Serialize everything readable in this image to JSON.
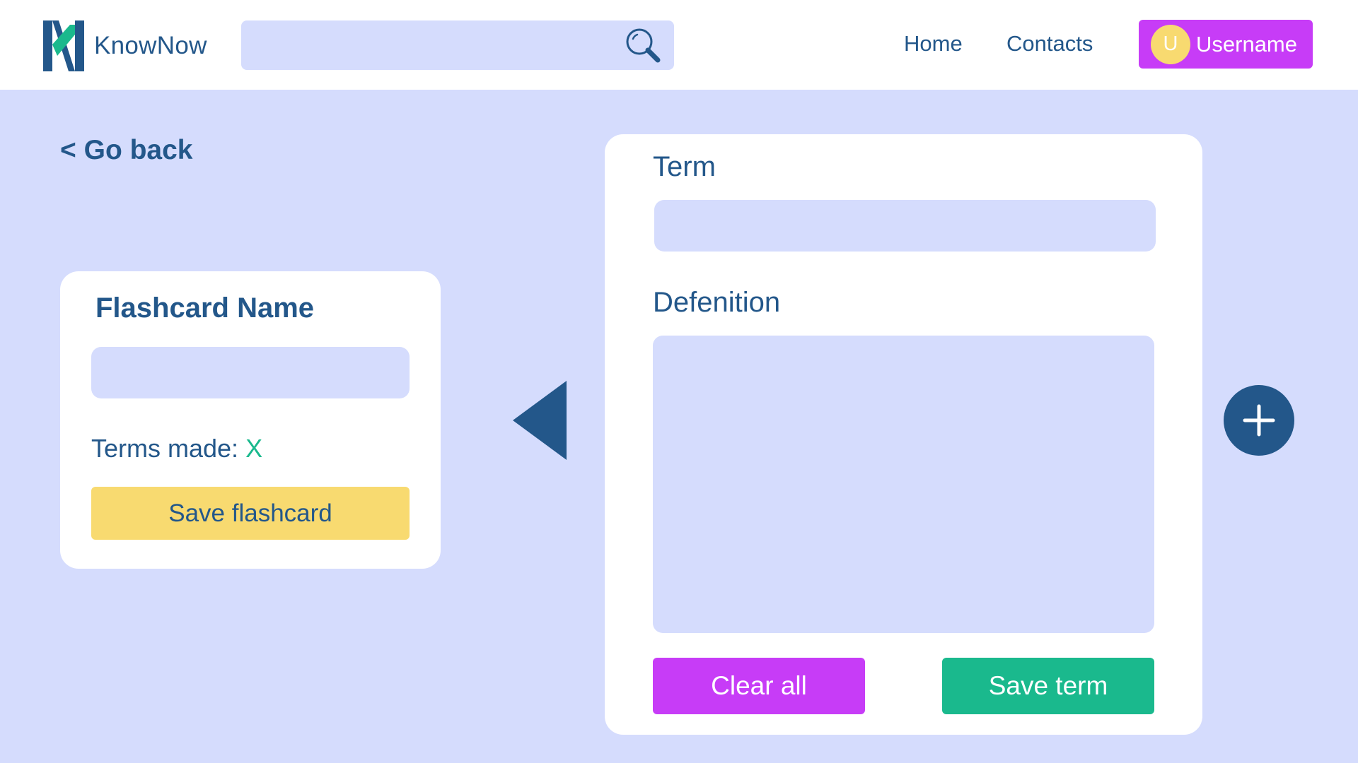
{
  "header": {
    "brand": "KnowNow",
    "search": {
      "placeholder": "",
      "value": "",
      "icon": "search-icon"
    },
    "nav": [
      {
        "label": "Home"
      },
      {
        "label": "Contacts"
      }
    ],
    "user": {
      "avatar_initial": "U",
      "name": "Username"
    }
  },
  "go_back_label": "< Go back",
  "flashcard_panel": {
    "title": "Flashcard Name",
    "name_value": "",
    "terms_made_label": "Terms made:",
    "terms_made_count": "X",
    "save_label": "Save flashcard"
  },
  "term_panel": {
    "term_label": "Term",
    "term_value": "",
    "definition_label": "Defenition",
    "definition_value": "",
    "clear_label": "Clear all",
    "save_label": "Save term"
  },
  "icons": {
    "prev": "triangle-left-icon",
    "add": "plus-icon"
  },
  "colors": {
    "background": "#d5dcfd",
    "primary_text": "#23578a",
    "accent_purple": "#c73cf7",
    "accent_green": "#1ab98d",
    "accent_yellow": "#f8da70"
  }
}
